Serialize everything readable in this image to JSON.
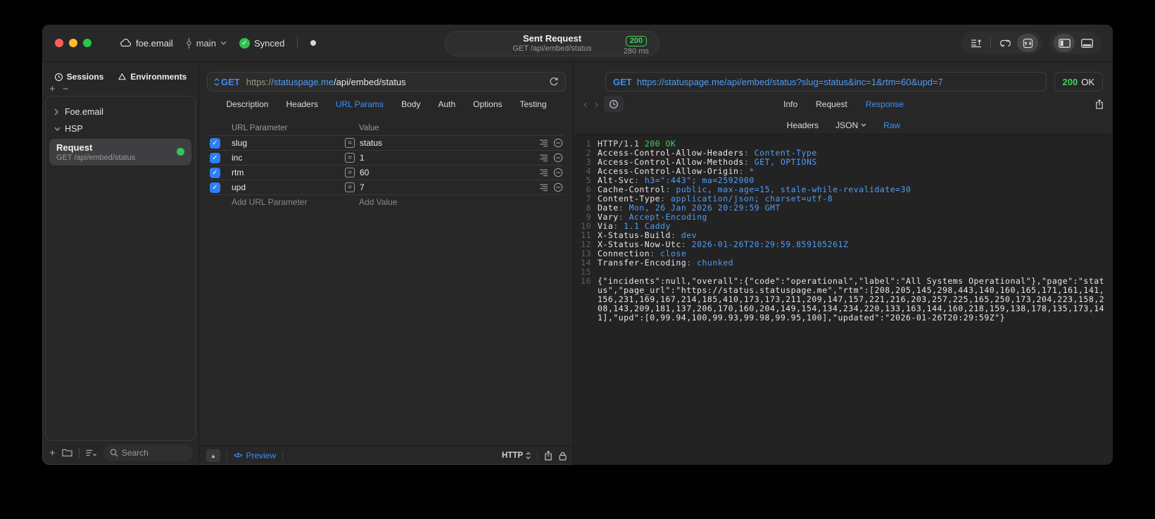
{
  "titlebar": {
    "project": "foe.email",
    "branch": "main",
    "sync_status": "Synced",
    "request_title": "Sent Request",
    "request_subtitle": "GET /api/embed/status",
    "status_code": "200",
    "duration": "280 ms"
  },
  "sidebar": {
    "tabs": [
      {
        "label": "Sessions"
      },
      {
        "label": "Environments"
      }
    ],
    "tree": [
      {
        "label": "Foe.email"
      },
      {
        "label": "HSP"
      }
    ],
    "selected_request": {
      "name": "Request",
      "subtitle": "GET /api/embed/status"
    },
    "search_placeholder": "Search"
  },
  "request_panel": {
    "method": "GET",
    "url_scheme": "https://",
    "url_host": "statuspage.me",
    "url_path": "/api/embed/status",
    "tabs": [
      "Description",
      "Headers",
      "URL Params",
      "Body",
      "Auth",
      "Options",
      "Testing"
    ],
    "active_tab": "URL Params",
    "param_table": {
      "columns": {
        "name": "URL Parameter",
        "value": "Value"
      },
      "rows": [
        {
          "name": "slug",
          "value": "status",
          "enabled": true
        },
        {
          "name": "inc",
          "value": "1",
          "enabled": true
        },
        {
          "name": "rtm",
          "value": "60",
          "enabled": true
        },
        {
          "name": "upd",
          "value": "7",
          "enabled": true
        }
      ],
      "add_name_placeholder": "Add URL Parameter",
      "add_value_placeholder": "Add Value"
    },
    "footer": {
      "preview_label": "Preview",
      "code_glyph": "</>",
      "protocol": "HTTP"
    }
  },
  "response_panel": {
    "request_line": {
      "method": "GET",
      "url": "https://statuspage.me/api/embed/status?slug=status&inc=1&rtm=60&upd=7"
    },
    "status": {
      "code": "200",
      "text": "OK"
    },
    "tabs": [
      "Info",
      "Request",
      "Response"
    ],
    "active_tab": "Response",
    "subtabs": [
      "Headers",
      "JSON",
      "Raw"
    ],
    "active_subtab": "Raw",
    "console": {
      "status_line": {
        "num": "1",
        "protocol": "HTTP/1.1 ",
        "status": "200 OK"
      },
      "headers": [
        {
          "num": "2",
          "name": "Access-Control-Allow-Headers",
          "value": "Content-Type"
        },
        {
          "num": "3",
          "name": "Access-Control-Allow-Methods",
          "value": "GET, OPTIONS"
        },
        {
          "num": "4",
          "name": "Access-Control-Allow-Origin",
          "value": "*"
        },
        {
          "num": "5",
          "name": "Alt-Svc",
          "value": "h3=\":443\"; ma=2592000"
        },
        {
          "num": "6",
          "name": "Cache-Control",
          "value": "public, max-age=15, stale-while-revalidate=30"
        },
        {
          "num": "7",
          "name": "Content-Type",
          "value": "application/json; charset=utf-8"
        },
        {
          "num": "8",
          "name": "Date",
          "value": "Mon, 26 Jan 2026 20:29:59 GMT"
        },
        {
          "num": "9",
          "name": "Vary",
          "value": "Accept-Encoding"
        },
        {
          "num": "10",
          "name": "Via",
          "value": "1.1 Caddy"
        },
        {
          "num": "11",
          "name": "X-Status-Build",
          "value": "dev"
        },
        {
          "num": "12",
          "name": "X-Status-Now-Utc",
          "value": "2026-01-26T20:29:59.859105261Z"
        },
        {
          "num": "13",
          "name": "Connection",
          "value": "close"
        },
        {
          "num": "14",
          "name": "Transfer-Encoding",
          "value": "chunked"
        }
      ],
      "blank_line_num": "15",
      "body_line": {
        "num": "16",
        "text": "{\"incidents\":null,\"overall\":{\"code\":\"operational\",\"label\":\"All Systems Operational\"},\"page\":\"status\",\"page_url\":\"https://status.statuspage.me\",\"rtm\":[208,205,145,298,443,140,160,165,171,161,141,156,231,169,167,214,185,410,173,173,211,209,147,157,221,216,203,257,225,165,250,173,204,223,158,208,143,209,181,137,206,170,160,204,149,154,134,234,220,133,163,144,160,218,159,138,178,135,173,141],\"upd\":[0,99.94,100,99.93,99.98,99.95,100],\"updated\":\"2026-01-26T20:29:59Z\"}"
      }
    }
  },
  "icons": {
    "traffic-lights": [
      "#ff5f57",
      "#febc2e",
      "#28c840"
    ],
    "named": [
      "cloud-icon",
      "branch-icon",
      "chevron-down-icon",
      "sync-check-icon",
      "export-lines-icon",
      "loop-icon",
      "import-box-icon",
      "layout-sidebar-icon",
      "layout-bottombar-icon",
      "sessions-clock-icon",
      "environments-icon",
      "plus-icon",
      "minus-icon",
      "folder-icon",
      "sort-list-icon",
      "search-icon",
      "refresh-icon",
      "format-lines-icon",
      "remove-circle-icon",
      "collapse-icon",
      "code-icon",
      "share-icon",
      "lock-icon",
      "history-clock-icon",
      "nav-back-icon",
      "nav-forward-icon",
      "updown-arrows-icon",
      "equals-icon",
      "checkbox-check-icon",
      "status-dot"
    ]
  },
  "colors": {
    "accent_blue": "#3f8ef7",
    "value_blue": "#4f9cf8",
    "green": "#3fd158",
    "muted": "#98989d",
    "window_bg": "#272727",
    "console_bg": "#232323"
  }
}
